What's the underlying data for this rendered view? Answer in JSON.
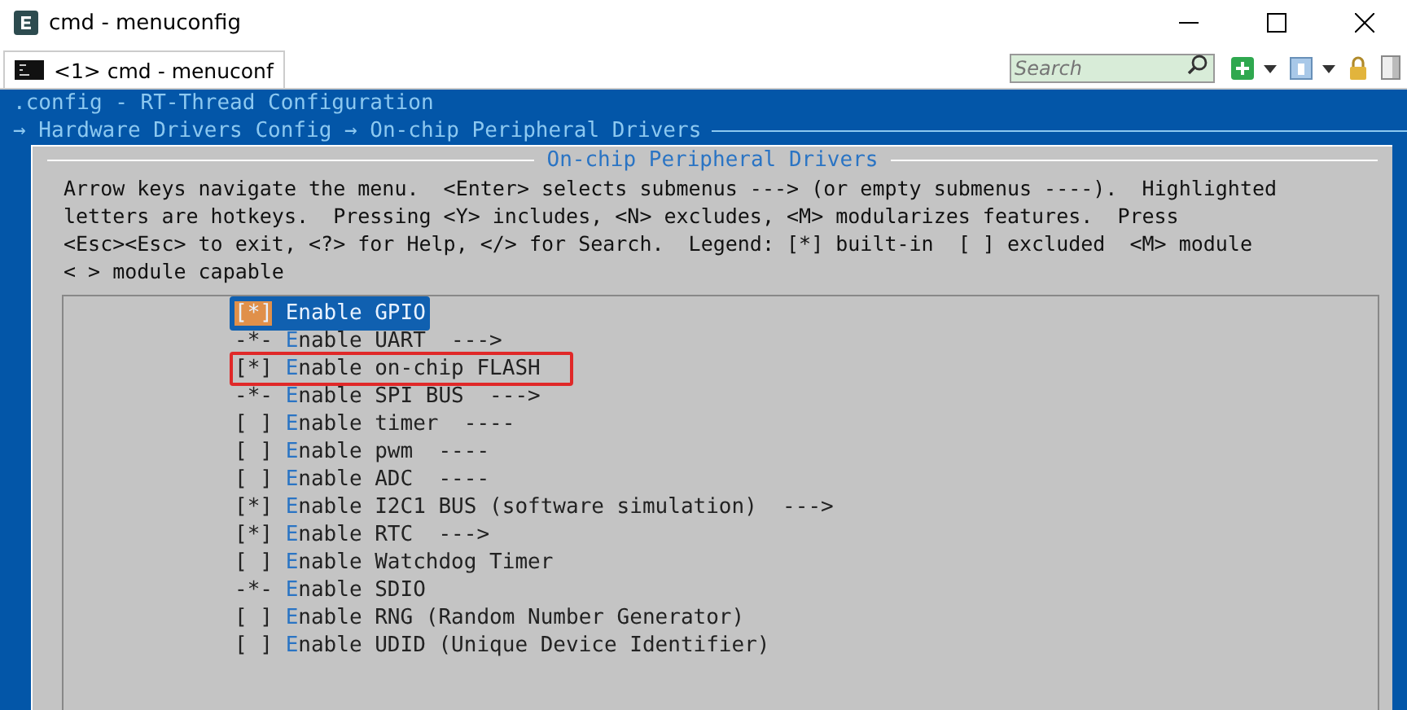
{
  "window": {
    "title": "cmd - menuconfig"
  },
  "tabs": [
    {
      "label": "<1> cmd - menuconf",
      "selected": true
    }
  ],
  "search": {
    "placeholder": "Search"
  },
  "terminal": {
    "header": ".config - RT-Thread Configuration",
    "breadcrumb": "→ Hardware Drivers Config → On-chip Peripheral Drivers",
    "dialog_title": "On-chip Peripheral Drivers",
    "help": [
      "Arrow keys navigate the menu.  <Enter> selects submenus ---> (or empty submenus ----).  Highlighted",
      "letters are hotkeys.  Pressing <Y> includes, <N> excludes, <M> modularizes features.  Press",
      "<Esc><Esc> to exit, <?> for Help, </> for Search.  Legend: [*] built-in  [ ] excluded  <M> module",
      "< > module capable"
    ],
    "items": [
      {
        "prefix": "[*]",
        "hotkey": "E",
        "label": "nable GPIO",
        "selected": true,
        "outlined": false
      },
      {
        "prefix": "-*-",
        "hotkey": "E",
        "label": "nable UART  --->",
        "selected": false,
        "outlined": false
      },
      {
        "prefix": "[*]",
        "hotkey": "E",
        "label": "nable on-chip FLASH",
        "selected": false,
        "outlined": true
      },
      {
        "prefix": "-*-",
        "hotkey": "E",
        "label": "nable SPI BUS  --->",
        "selected": false,
        "outlined": false
      },
      {
        "prefix": "[ ]",
        "hotkey": "E",
        "label": "nable timer  ----",
        "selected": false,
        "outlined": false
      },
      {
        "prefix": "[ ]",
        "hotkey": "E",
        "label": "nable pwm  ----",
        "selected": false,
        "outlined": false
      },
      {
        "prefix": "[ ]",
        "hotkey": "E",
        "label": "nable ADC  ----",
        "selected": false,
        "outlined": false
      },
      {
        "prefix": "[*]",
        "hotkey": "E",
        "label": "nable I2C1 BUS (software simulation)  --->",
        "selected": false,
        "outlined": false
      },
      {
        "prefix": "[*]",
        "hotkey": "E",
        "label": "nable RTC  --->",
        "selected": false,
        "outlined": false
      },
      {
        "prefix": "[ ]",
        "hotkey": "E",
        "label": "nable Watchdog Timer",
        "selected": false,
        "outlined": false
      },
      {
        "prefix": "-*-",
        "hotkey": "E",
        "label": "nable SDIO",
        "selected": false,
        "outlined": false
      },
      {
        "prefix": "[ ]",
        "hotkey": "E",
        "label": "nable RNG (Random Number Generator)",
        "selected": false,
        "outlined": false
      },
      {
        "prefix": "[ ]",
        "hotkey": "E",
        "label": "nable UDID (Unique Device Identifier)",
        "selected": false,
        "outlined": false
      }
    ]
  }
}
